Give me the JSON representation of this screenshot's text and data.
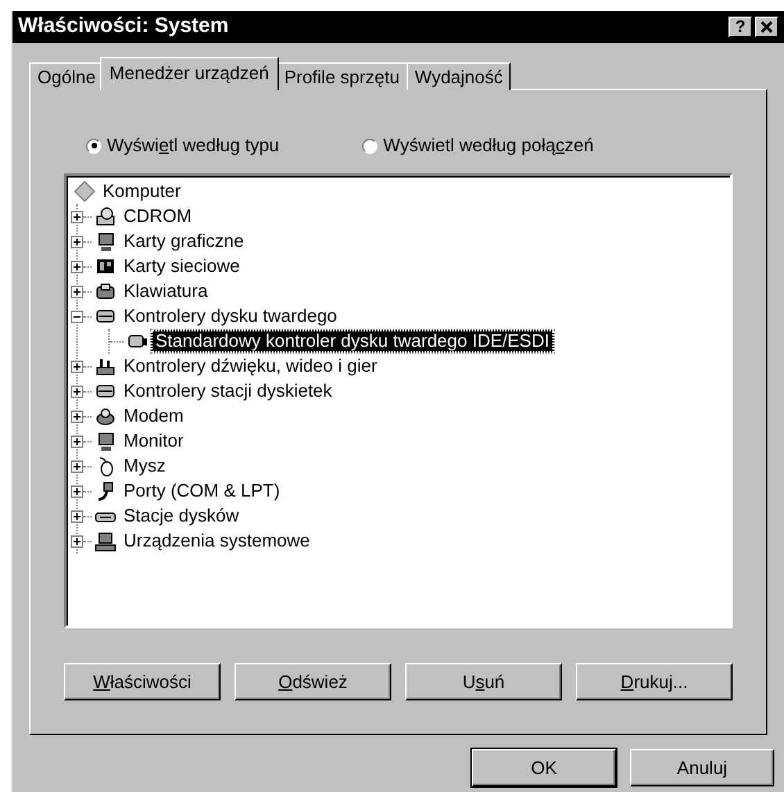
{
  "window": {
    "title": "Właściwości: System",
    "help": "?"
  },
  "tabs": [
    {
      "label": "Ogólne",
      "selected": false
    },
    {
      "label": "Menedżer urządzeń",
      "selected": true
    },
    {
      "label": "Profile sprzętu",
      "selected": false
    },
    {
      "label": "Wydajność",
      "selected": false
    }
  ],
  "view_options": [
    {
      "text_before": "Wyświ",
      "mnemonic": "e",
      "text_after": "tl według typu",
      "selected": true
    },
    {
      "text_before": "Wyświetl według połą",
      "mnemonic": "c",
      "text_after": "zeń",
      "selected": false
    }
  ],
  "tree": {
    "label": "Komputer",
    "children": [
      {
        "label": "CDROM",
        "expanded": false,
        "selected": false
      },
      {
        "label": "Karty graficzne",
        "expanded": false,
        "selected": false
      },
      {
        "label": "Karty sieciowe",
        "expanded": false,
        "selected": false
      },
      {
        "label": "Klawiatura",
        "expanded": false,
        "selected": false
      },
      {
        "label": "Kontrolery dysku twardego",
        "expanded": true,
        "selected": false,
        "children": [
          {
            "label": "Standardowy kontroler dysku twardego IDE/ESDI",
            "selected": true
          }
        ]
      },
      {
        "label": "Kontrolery dźwięku, wideo i gier",
        "expanded": false,
        "selected": false
      },
      {
        "label": "Kontrolery stacji dyskietek",
        "expanded": false,
        "selected": false
      },
      {
        "label": "Modem",
        "expanded": false,
        "selected": false
      },
      {
        "label": "Monitor",
        "expanded": false,
        "selected": false
      },
      {
        "label": "Mysz",
        "expanded": false,
        "selected": false
      },
      {
        "label": "Porty (COM & LPT)",
        "expanded": false,
        "selected": false
      },
      {
        "label": "Stacje dysków",
        "expanded": false,
        "selected": false
      },
      {
        "label": "Urządzenia systemowe",
        "expanded": false,
        "selected": false
      }
    ]
  },
  "action_buttons": [
    {
      "mnemonic": "W",
      "text_after": "łaściwości"
    },
    {
      "mnemonic": "O",
      "text_after": "dśwież"
    },
    {
      "text_before": "U",
      "mnemonic": "s",
      "text_after": "uń"
    },
    {
      "mnemonic": "D",
      "text_after": "rukuj..."
    }
  ],
  "dialog_buttons": [
    {
      "label": "OK",
      "default": true
    },
    {
      "label": "Anuluj",
      "default": false
    }
  ]
}
